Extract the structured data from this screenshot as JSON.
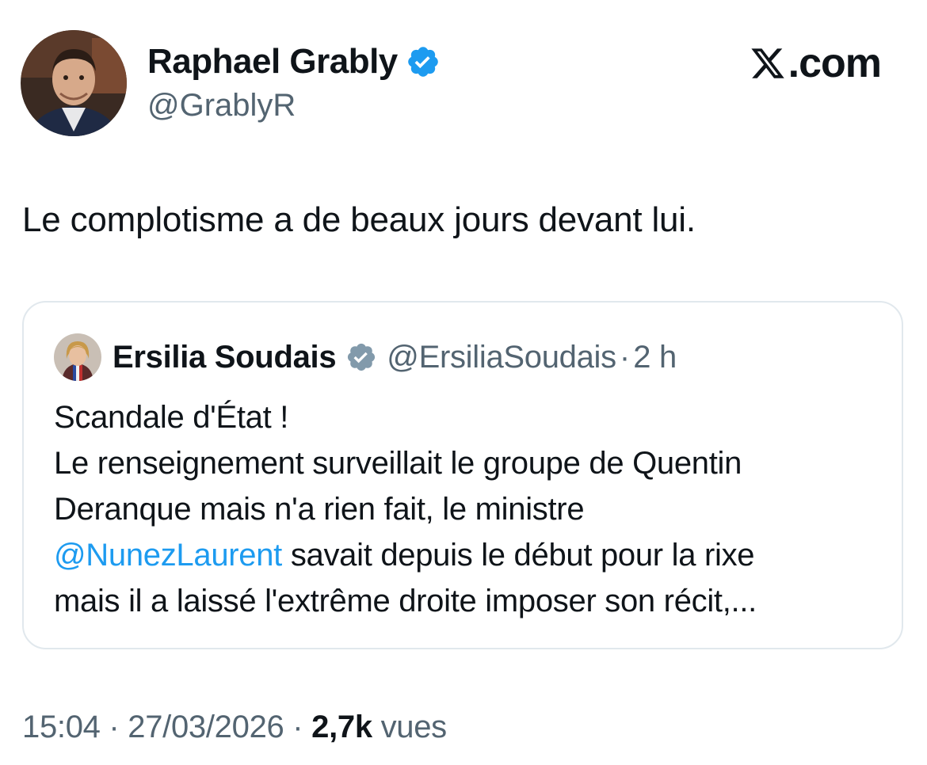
{
  "author": {
    "name": "Raphael Grably",
    "handle": "@GrablyR",
    "verified": true
  },
  "brand": {
    "logo": "x-logo-icon",
    "text": ".com"
  },
  "tweet": {
    "text": "Le complotisme a de beaux jours devant lui."
  },
  "quoted": {
    "name": "Ersilia Soudais",
    "handle": "@ErsiliaSoudais",
    "separator": "·",
    "time": "2 h",
    "verified": true,
    "lines": {
      "l1": "Scandale d'État !",
      "l2": "Le renseignement surveillait le groupe de Quentin",
      "l3": "Deranque mais n'a rien fait, le ministre",
      "l4_mention": "@NunezLaurent",
      "l4_rest": " savait depuis le début pour la rixe",
      "l5": "mais il a laissé l'extrême droite imposer son récit,..."
    }
  },
  "meta": {
    "time": "15:04",
    "sep1": " · ",
    "date": "27/03/2026",
    "sep2": " · ",
    "views_count": "2,7k",
    "views_label": " vues"
  },
  "colors": {
    "text": "#0f1419",
    "secondary": "#536471",
    "link": "#1d9bf0",
    "verified_blue": "#1d9bf0",
    "verified_gray": "#829aab",
    "border": "#e1e8ed"
  }
}
